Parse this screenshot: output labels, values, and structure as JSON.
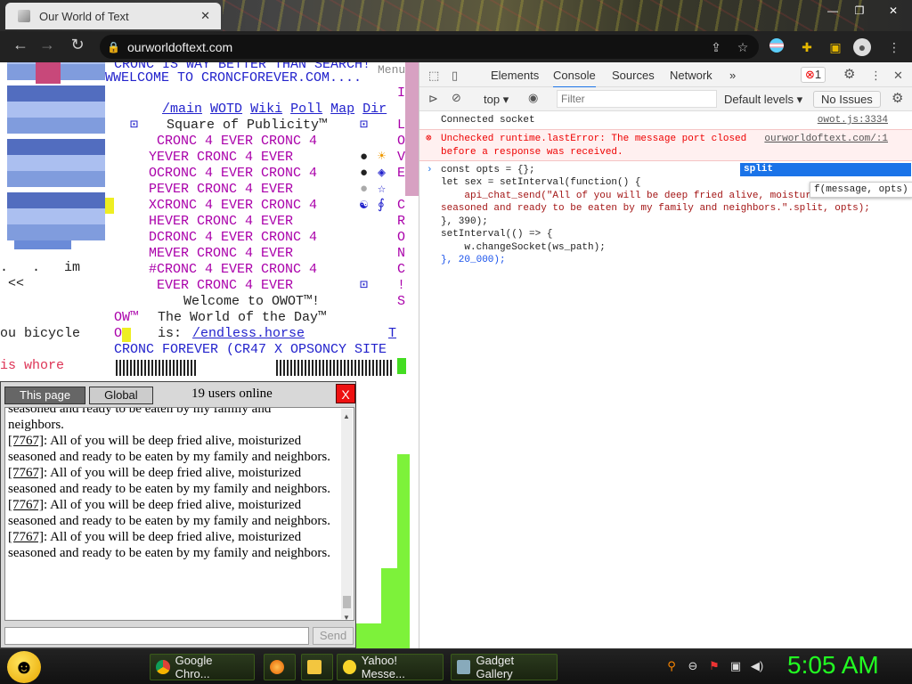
{
  "browser": {
    "tab_title": "Our World of Text",
    "tab_close": "✕",
    "url": "ourworldoftext.com",
    "window_buttons": [
      "—",
      "❐",
      "✕"
    ]
  },
  "page": {
    "top_line": "CRONC IS WAY BETTER THAN SEARCH!",
    "menu_label": "Menu",
    "welcome_line": "WWELCOME TO CRONCFOREVER.COM....",
    "nav_links": [
      "/main",
      "WOTD",
      "Wiki",
      "Poll",
      "Map",
      "Dir"
    ],
    "square_title": "Square of Publicity™",
    "cronc_lines": [
      " CRONC 4 EVER CRONC 4",
      "YEVER CRONC 4 EVER",
      "OCRONC 4 EVER CRONC 4",
      "PEVER CRONC 4 EVER",
      "XCRONC 4 EVER CRONC 4",
      "HEVER CRONC 4 EVER",
      "DCRONC 4 EVER CRONC 4",
      "MEVER CRONC 4 EVER",
      "#CRONC 4 EVER CRONC 4",
      " EVER CRONC 4 EVER"
    ],
    "right_column": [
      "I",
      "L",
      "O",
      "V",
      "E",
      "C",
      "R",
      "O",
      "N",
      "C",
      "!",
      "S"
    ],
    "welcome_owot": "Welcome to OWOT™!",
    "world_of_day_label": "The World of the Day™",
    "world_of_day_is": "is:",
    "world_of_day_link": "/endless.horse",
    "world_of_day_t": "T",
    "ow_prefix": "OW™",
    "o_prefix": "O",
    "cronc_forever": "CRONC FOREVER (CR47 X OPSONCY SITE",
    "left_im": ".   .   im",
    "left_arrows": " <<",
    "left_bicycle": "ou bicycle",
    "left_whore": "is whore"
  },
  "chat": {
    "tab_page": "This page",
    "tab_global": "Global",
    "online": "19 users online",
    "close": "X",
    "partial_top": "seasoned and ready to be eaten by my family and",
    "partial_end": "neighbors.",
    "messages": [
      {
        "id": "[7767]",
        "text": ": All of you will be deep fried alive, moisturized seasoned and ready to be eaten by my family and neighbors."
      },
      {
        "id": "[7767]",
        "text": ": All of you will be deep fried alive, moisturized seasoned and ready to be eaten by my family and neighbors."
      },
      {
        "id": "[7767]",
        "text": ": All of you will be deep fried alive, moisturized seasoned and ready to be eaten by my family and neighbors."
      },
      {
        "id": "[7767]",
        "text": ": All of you will be deep fried alive, moisturized seasoned and ready to be eaten by my family and neighbors."
      }
    ],
    "send": "Send"
  },
  "devtools": {
    "tabs": [
      "Elements",
      "Console",
      "Sources",
      "Network"
    ],
    "more": "»",
    "error_count": "1",
    "context": "top",
    "filter_placeholder": "Filter",
    "levels": "Default levels",
    "issues": "No Issues",
    "log_connected": "Connected socket",
    "log_connected_src": "owot.js:3334",
    "error_line1": "Unchecked runtime.lastError: The message port closed",
    "error_line2": "before a response was received.",
    "error_src": "ourworldoftext.com/:1",
    "code": [
      "const opts = {};",
      "let sex = setInterval(function() {",
      "    api_chat_send(\"All of you will be deep fried alive, moistur",
      "seasoned and ready to be eaten by my family and neighbors.\".split, opts);",
      "}, 390);",
      "setInterval(() => {",
      "    w.changeSocket(ws_path);",
      "}, 20_000);"
    ],
    "autocomplete": "split",
    "hint": "f(message, opts)"
  },
  "taskbar": {
    "buttons": [
      "Google Chro...",
      "Yahoo! Messe...",
      "Gadget Gallery"
    ],
    "clock": "5:05 AM"
  },
  "colors": {
    "clock": "#22ff22",
    "error_bg": "#fff0f0",
    "autocomplete_bg": "#1a73e8"
  }
}
